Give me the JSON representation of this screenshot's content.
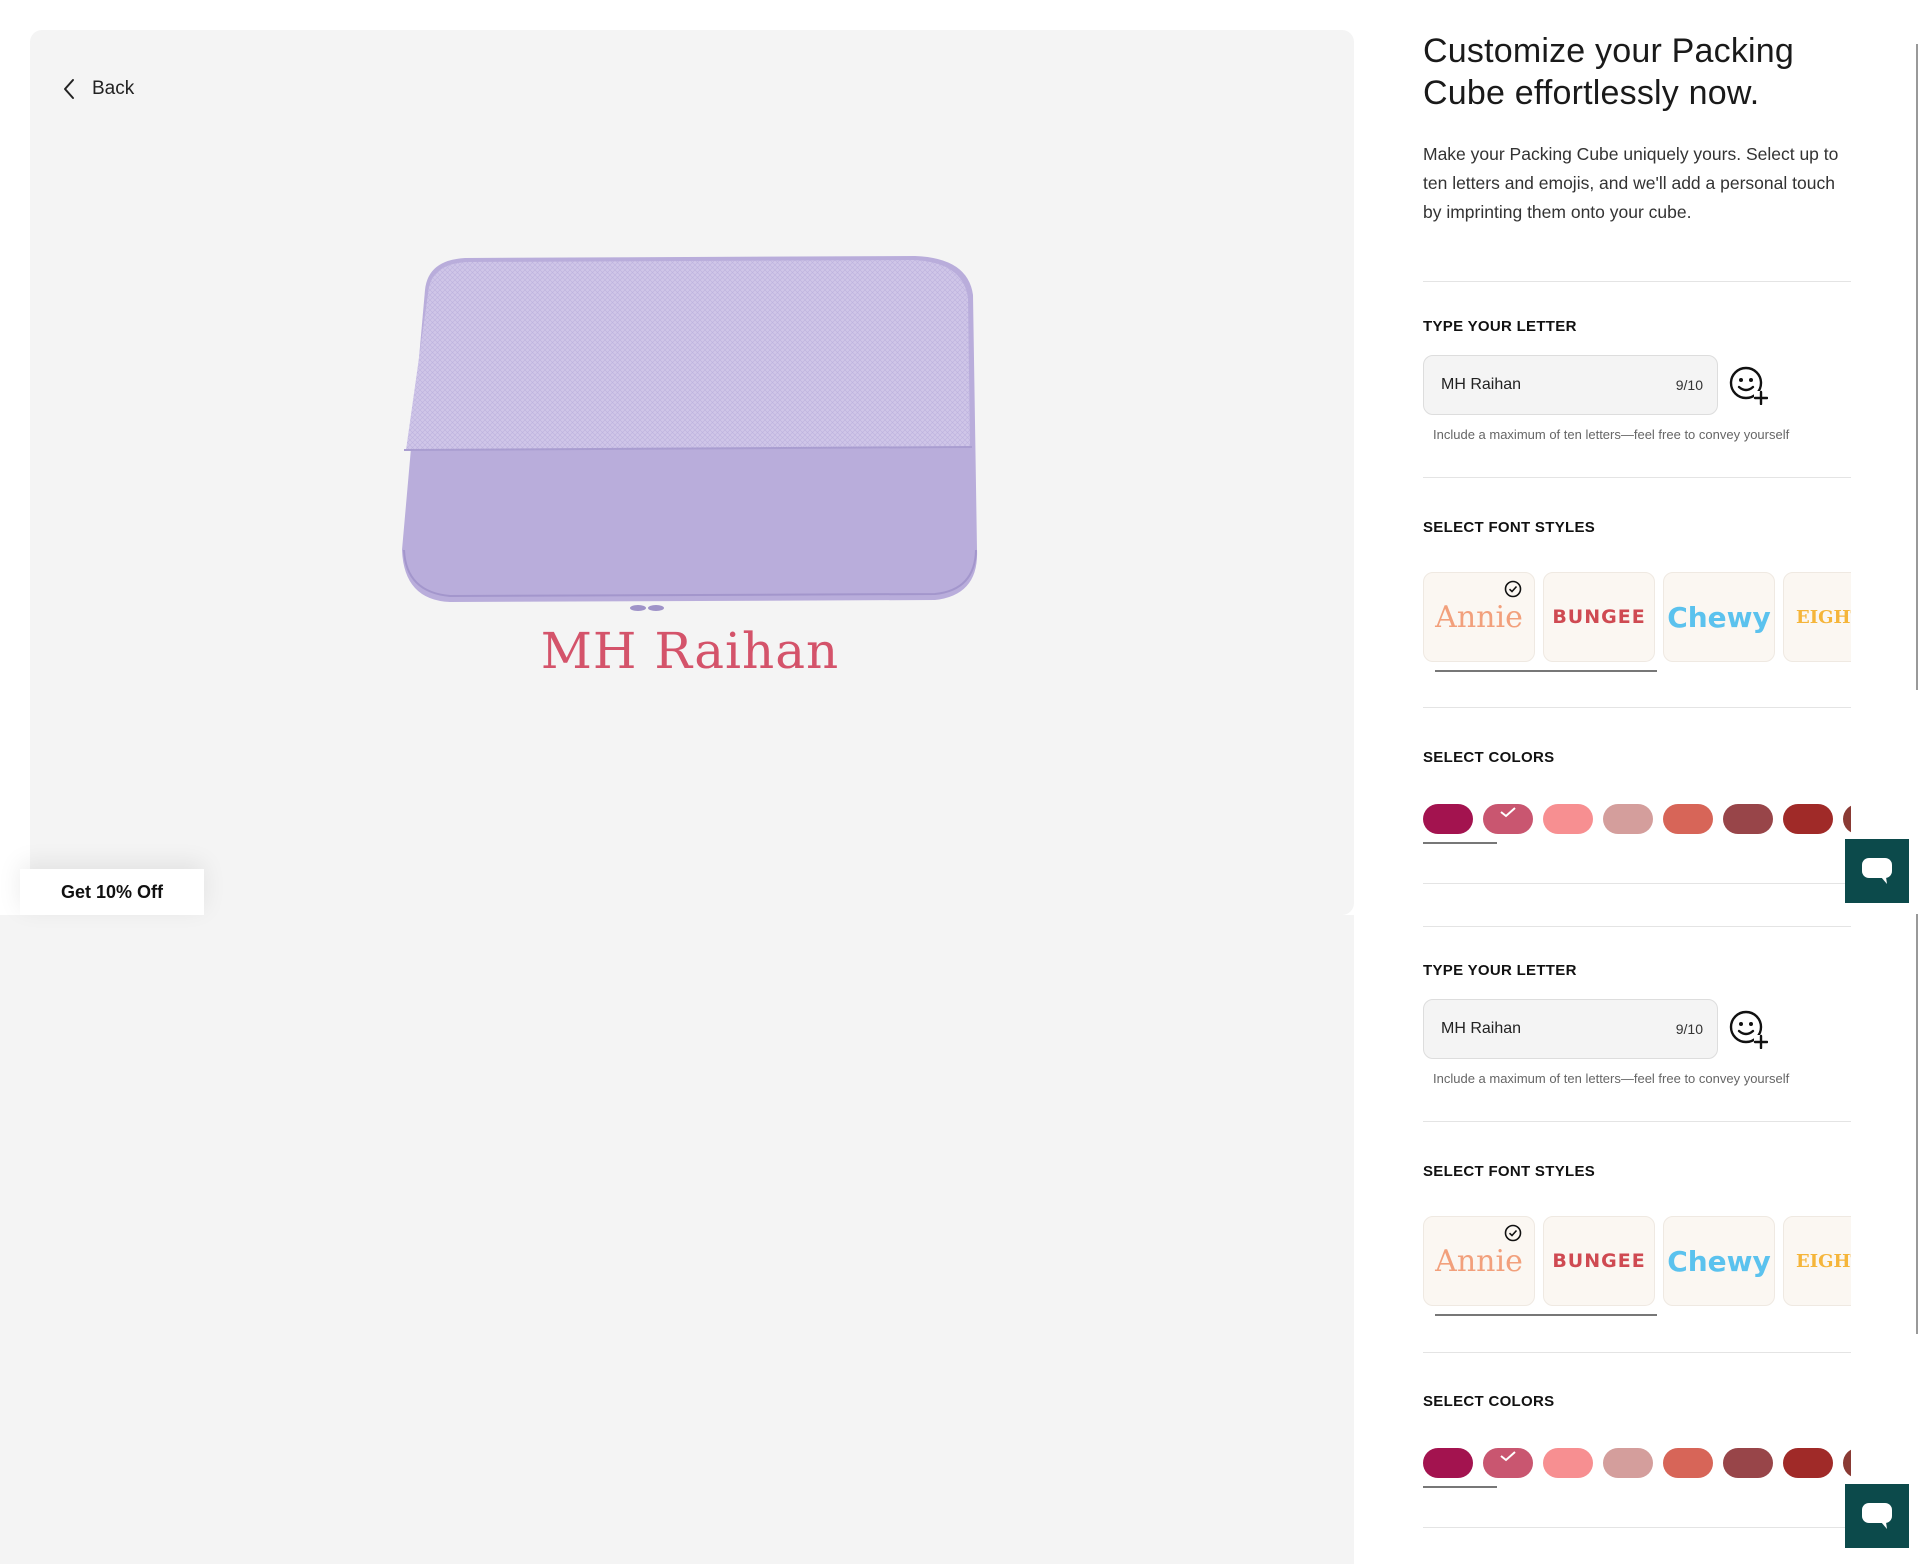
{
  "nav": {
    "back_label": "Back"
  },
  "preview": {
    "imprint_text": "MH Raihan",
    "promo_label": "Get 10% Off"
  },
  "header": {
    "title": "Customize your Packing Cube effortlessly now.",
    "description": "Make your Packing Cube uniquely yours. Select up to ten letters and emojis, and we'll add a personal touch by imprinting them onto your cube."
  },
  "letter": {
    "label": "TYPE YOUR LETTER",
    "value": "MH Raihan",
    "counter": "9/10",
    "hint": "Include a maximum of ten letters—feel free to convey yourself"
  },
  "font_styles": {
    "label": "SELECT FONT STYLES",
    "options": [
      "Annie",
      "BUNGEE",
      "Chewy",
      "EIGHT"
    ],
    "selected": "Annie"
  },
  "colors": {
    "label": "SELECT COLORS",
    "swatches": [
      "#a3134f",
      "#c95670",
      "#f78f91",
      "#d49e9c",
      "#d76558",
      "#984549",
      "#a02a28",
      "#8a3a34"
    ],
    "selected_index": 1
  },
  "theme": {
    "cube_color": "#b9addb",
    "chat_color": "#0c4a4b"
  }
}
